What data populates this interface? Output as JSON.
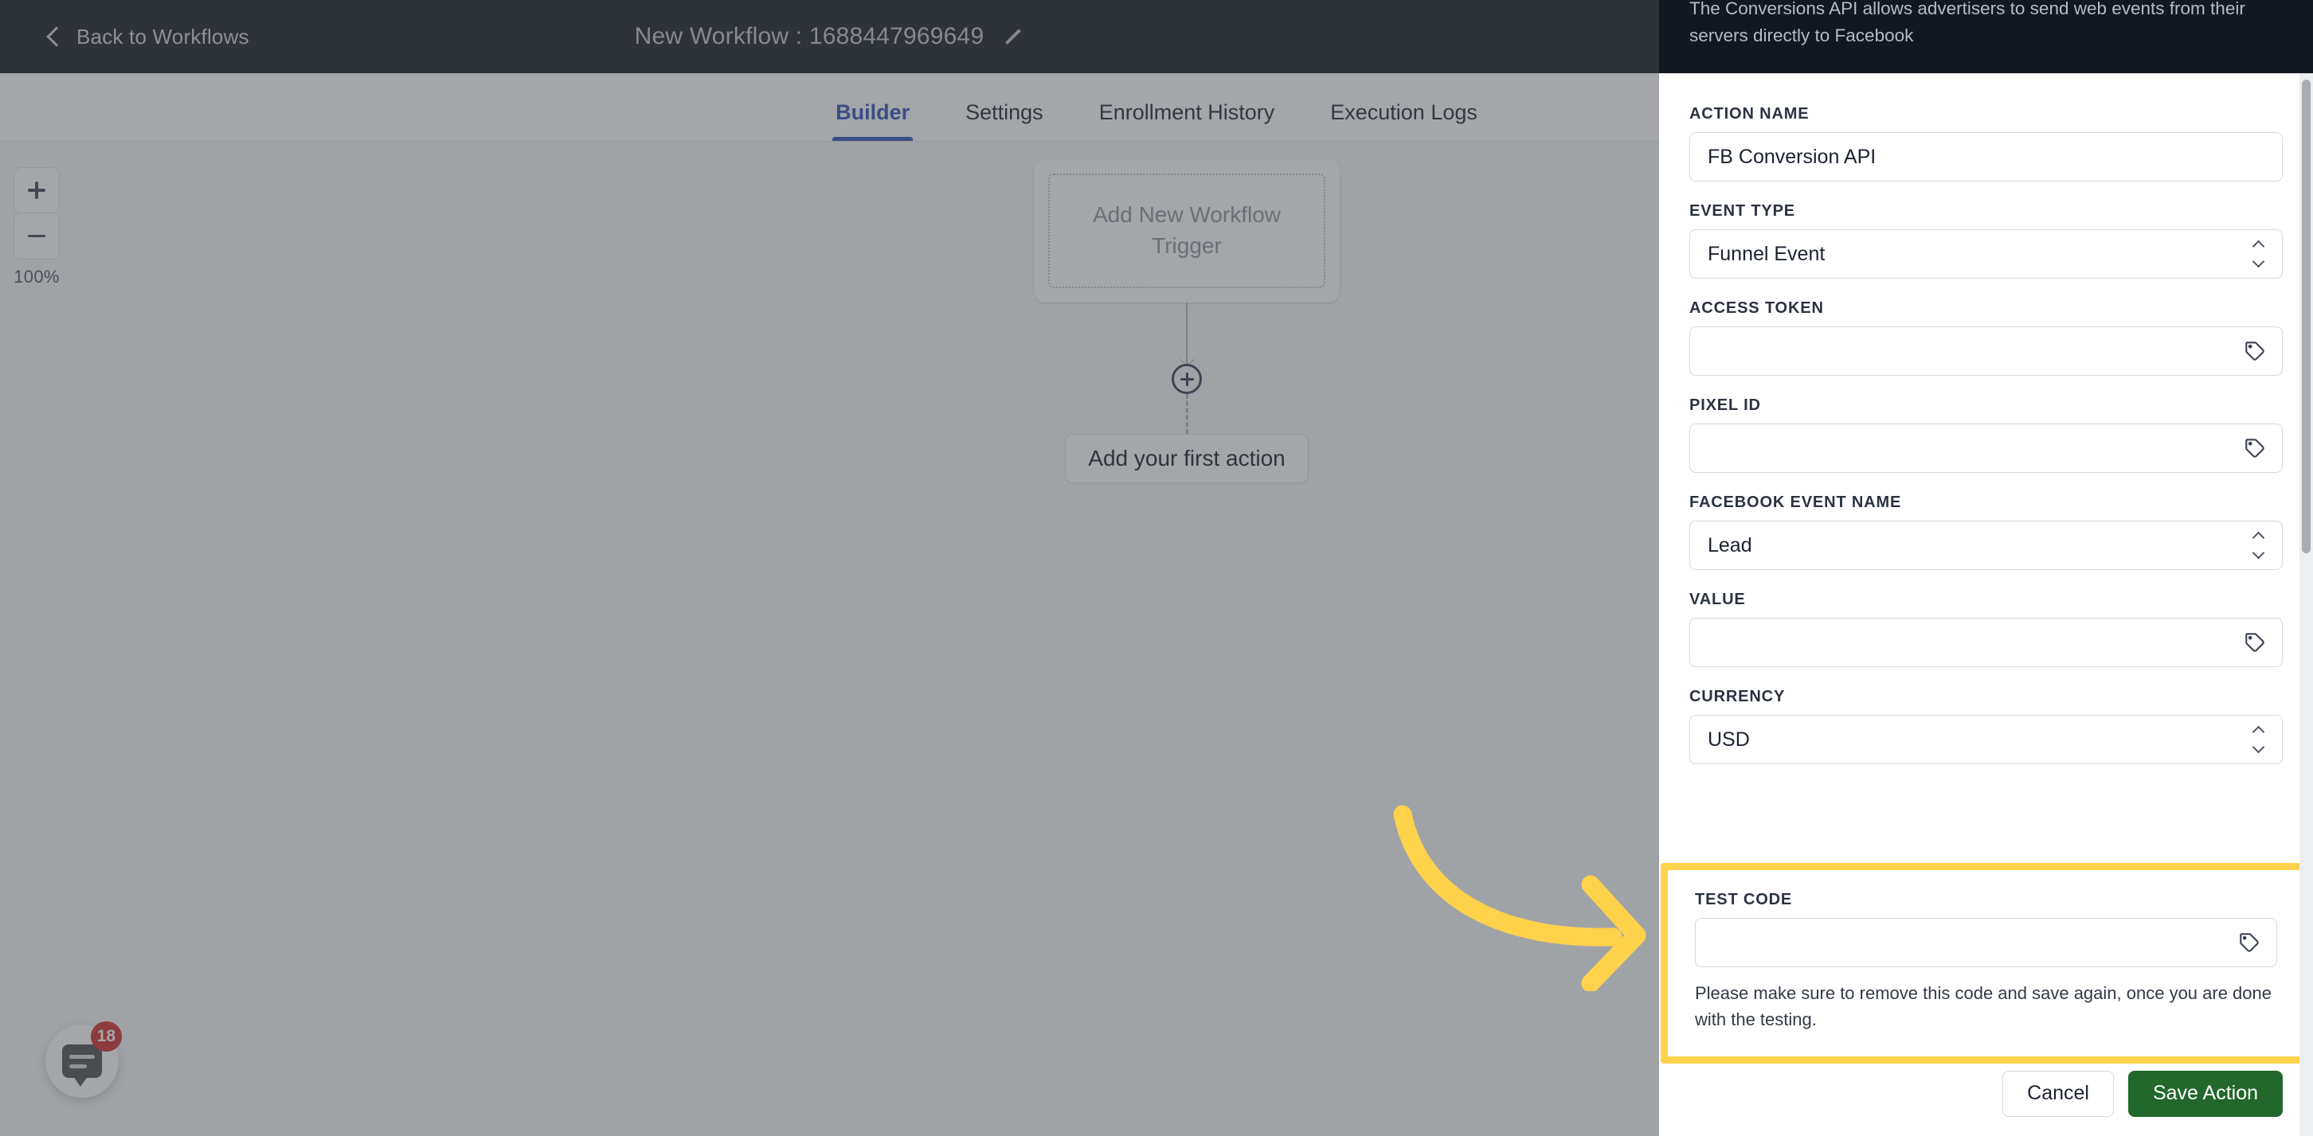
{
  "topbar": {
    "back_label": "Back to Workflows",
    "back_icon": "chevron-left-icon",
    "workflow_title": "New Workflow : 1688447969649",
    "edit_icon": "pencil-icon"
  },
  "tabs": [
    {
      "label": "Builder",
      "active": true
    },
    {
      "label": "Settings",
      "active": false
    },
    {
      "label": "Enrollment History",
      "active": false
    },
    {
      "label": "Execution Logs",
      "active": false
    }
  ],
  "canvas": {
    "zoom": {
      "zoom_in_icon": "plus-icon",
      "zoom_out_icon": "minus-icon",
      "level": "100%"
    },
    "trigger_card_text": "Add New Workflow Trigger",
    "add_node_icon": "plus-circle-icon",
    "first_action_label": "Add your first action"
  },
  "chat_widget": {
    "icon": "chat-bubble-icon",
    "badge_count": "18"
  },
  "panel": {
    "description": "The Conversions API allows advertisers to send web events from their servers directly to Facebook",
    "fields": [
      {
        "label": "ACTION NAME",
        "value": "FB Conversion API",
        "type": "text",
        "icon": ""
      },
      {
        "label": "EVENT TYPE",
        "value": "Funnel Event",
        "type": "select",
        "icon": "stepper-icon"
      },
      {
        "label": "ACCESS TOKEN",
        "value": "",
        "type": "text",
        "icon": "tag-icon"
      },
      {
        "label": "PIXEL ID",
        "value": "",
        "type": "text",
        "icon": "tag-icon"
      },
      {
        "label": "FACEBOOK EVENT NAME",
        "value": "Lead",
        "type": "select",
        "icon": "stepper-icon"
      },
      {
        "label": "VALUE",
        "value": "",
        "type": "text",
        "icon": "tag-icon"
      },
      {
        "label": "CURRENCY",
        "value": "USD",
        "type": "select",
        "icon": "stepper-icon"
      }
    ],
    "test_code": {
      "label": "TEST CODE",
      "value": "",
      "icon": "tag-icon",
      "hint": "Please make sure to remove this code and save again, once you are done with the testing.",
      "highlight_color": "#FFD24C"
    },
    "footer": {
      "cancel_label": "Cancel",
      "save_label": "Save Action",
      "save_color": "#21682A"
    }
  },
  "annotation": {
    "arrow_icon": "curved-arrow-right-icon",
    "arrow_color": "#FFD24C"
  }
}
